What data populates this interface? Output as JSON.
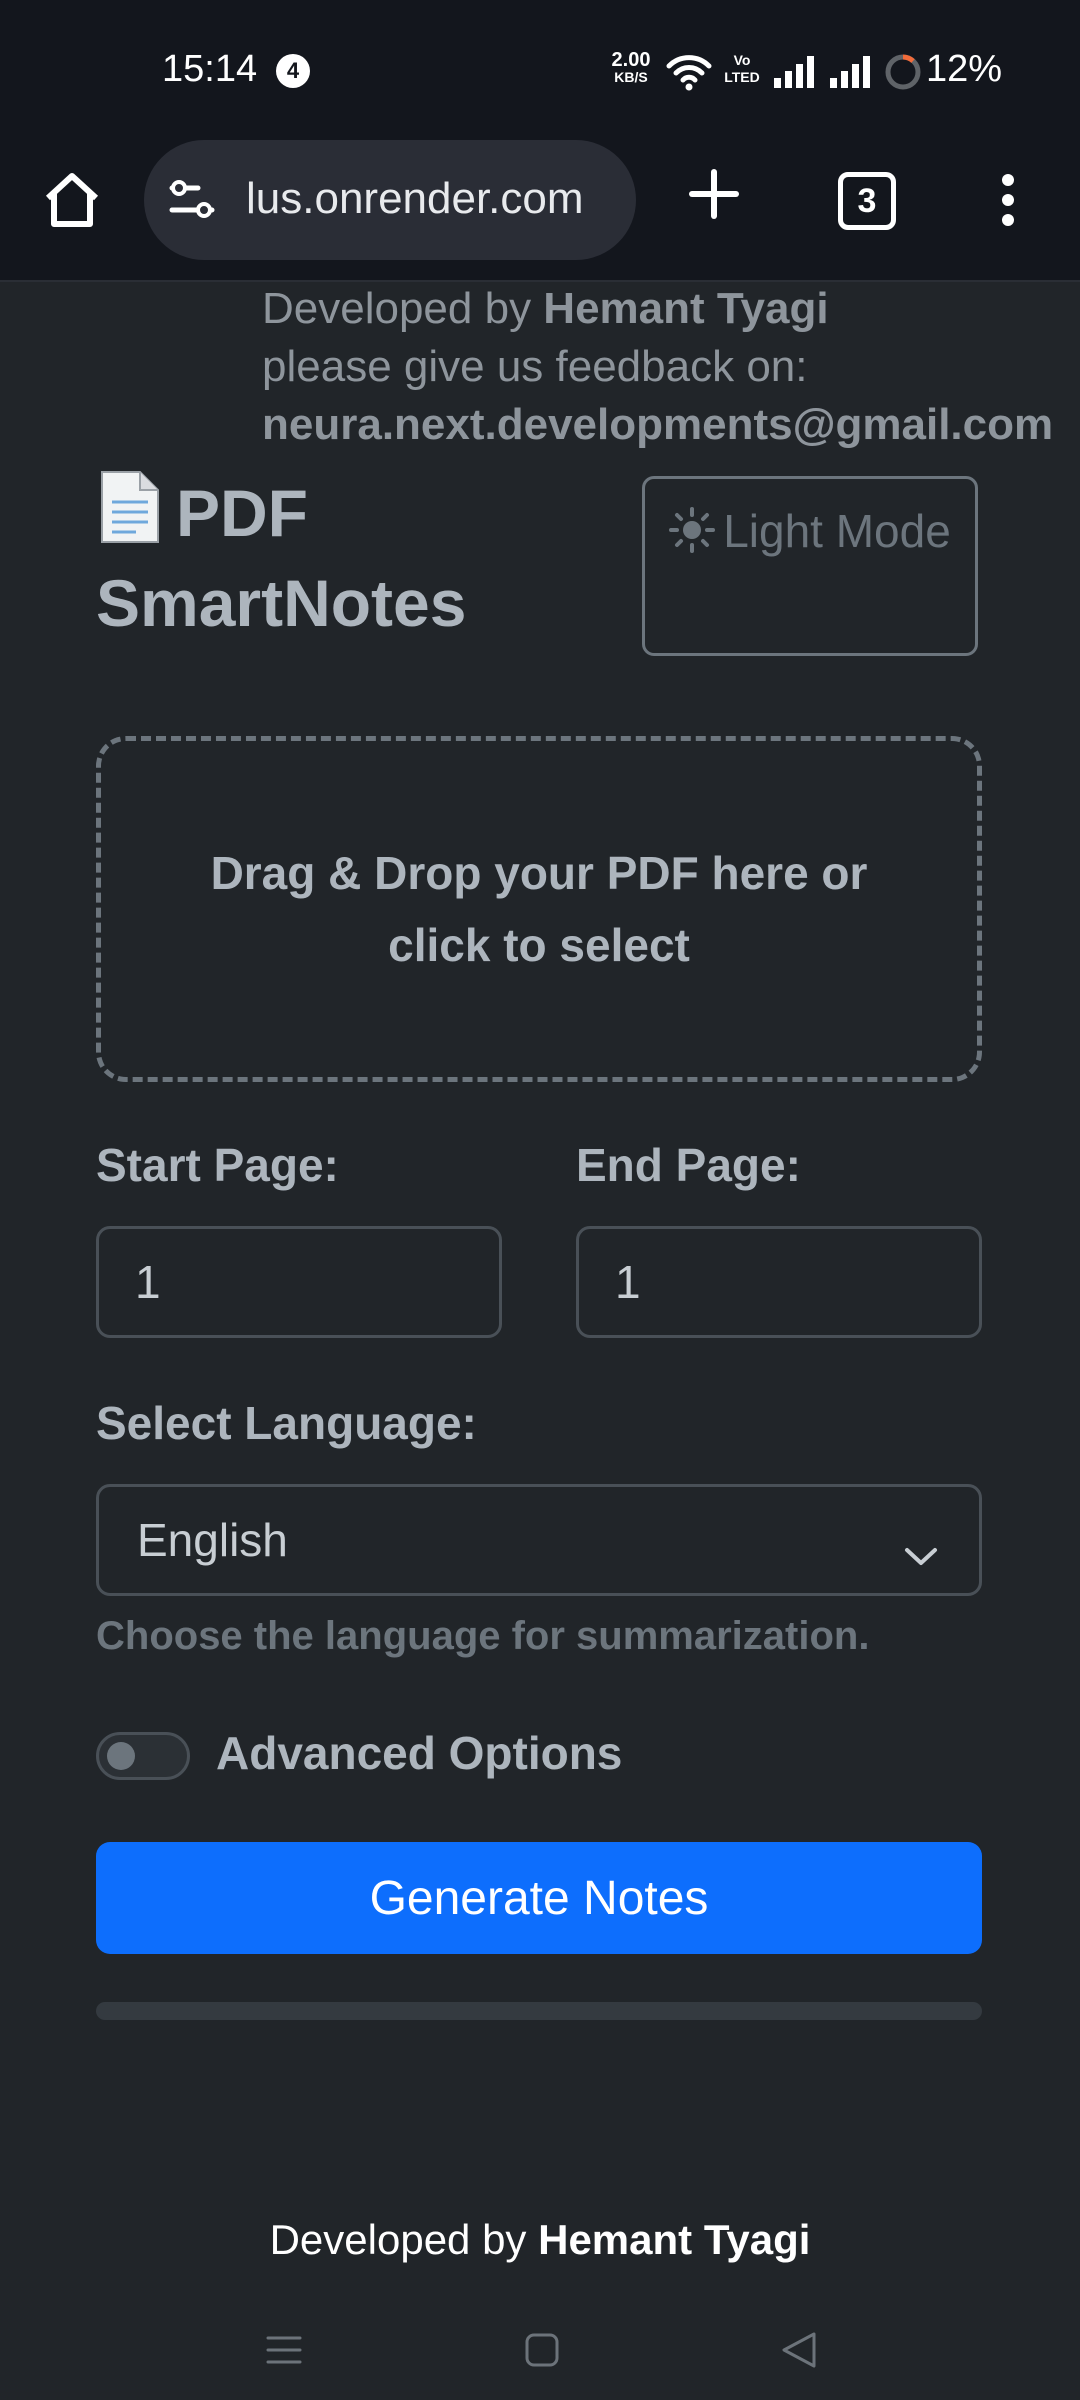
{
  "status_bar": {
    "time": "15:14",
    "notification_count": "4",
    "net_speed_value": "2.00",
    "net_speed_unit": "KB/S",
    "volte_top": "Vo",
    "volte_bottom": "LTED",
    "battery_percent": "12%",
    "battery_level": 0.12
  },
  "browser": {
    "url": "lus.onrender.com",
    "tab_count": "3",
    "icons": [
      "home-icon",
      "site-settings-icon",
      "new-tab-plus-icon",
      "tab-switcher-icon",
      "more-vert-icon"
    ]
  },
  "header": {
    "dev_prefix": "Developed by ",
    "dev_name": "Hemant Tyagi",
    "feedback_text": "please give us feedback on:",
    "feedback_email": "neura.next.developments@gmail.com",
    "app_title": "PDF SmartNotes",
    "mode_button_label": "Light Mode"
  },
  "upload": {
    "dropzone_text": "Drag & Drop your PDF here or click to select"
  },
  "form": {
    "start_page_label": "Start Page:",
    "start_page_value": "1",
    "end_page_label": "End Page:",
    "end_page_value": "1",
    "language_label": "Select Language:",
    "language_value": "English",
    "language_help": "Choose the language for summarization.",
    "advanced_label": "Advanced Options",
    "advanced_enabled": false,
    "generate_label": "Generate Notes",
    "progress": 0
  },
  "footer": {
    "prefix": "Developed by ",
    "name": "Hemant Tyagi"
  },
  "colors": {
    "page_bg": "#212529",
    "chrome_bg": "#13161d",
    "primary": "#0d6efd",
    "muted": "#6c757d",
    "text": "#adb5bd"
  }
}
